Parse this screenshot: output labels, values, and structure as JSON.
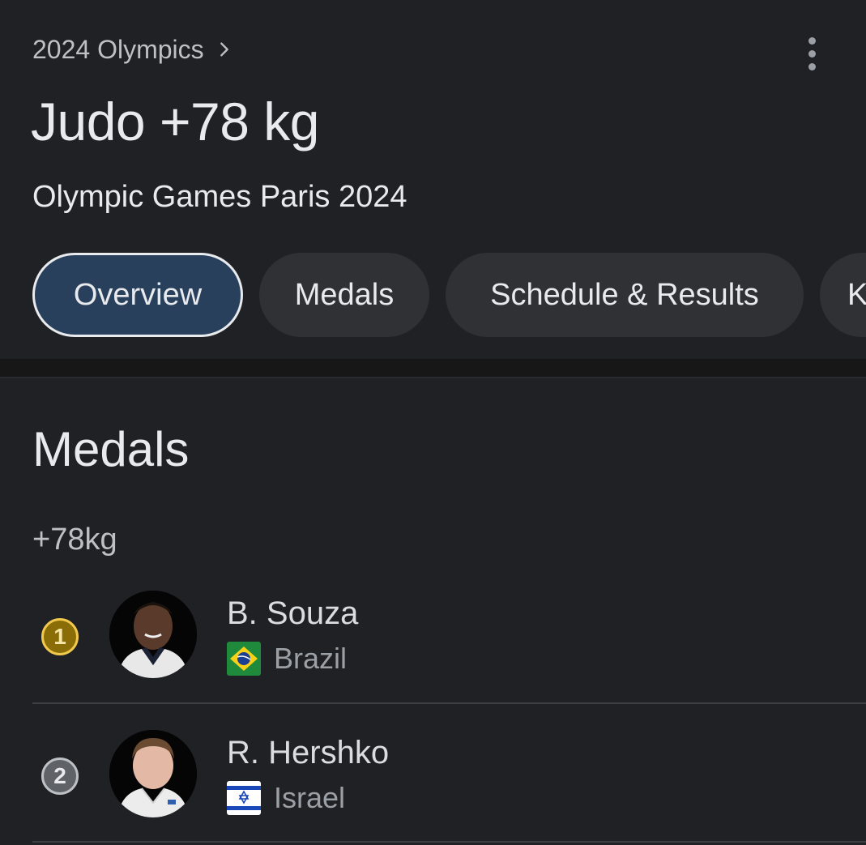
{
  "header": {
    "breadcrumb": "2024 Olympics",
    "title": "Judo +78 kg",
    "subtitle": "Olympic Games Paris 2024"
  },
  "tabs": [
    {
      "label": "Overview",
      "active": true
    },
    {
      "label": "Medals",
      "active": false
    },
    {
      "label": "Schedule & Results",
      "active": false
    },
    {
      "label": "K",
      "active": false
    }
  ],
  "medals": {
    "title": "Medals",
    "category": "+78kg",
    "rows": [
      {
        "rank": "1",
        "medal": "gold",
        "name": "B. Souza",
        "country": "Brazil",
        "flag_icon": "brazil-flag-icon"
      },
      {
        "rank": "2",
        "medal": "silver",
        "name": "R. Hershko",
        "country": "Israel",
        "flag_icon": "israel-flag-icon"
      }
    ]
  },
  "colors": {
    "background": "#202124",
    "active_tab": "#28405c",
    "tab": "#303134",
    "gold": "#8a6d06",
    "silver": "#5f6368"
  }
}
